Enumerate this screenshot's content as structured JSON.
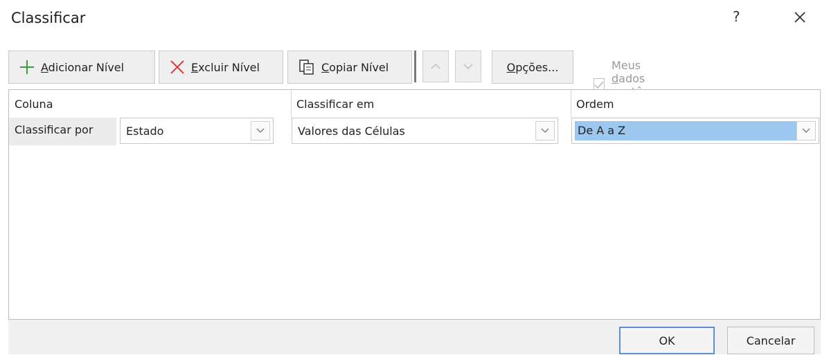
{
  "window": {
    "title": "Classificar",
    "help": "?"
  },
  "toolbar": {
    "add_level": {
      "mnemonic": "A",
      "rest": "dicionar Nível"
    },
    "delete_level": {
      "mnemonic": "E",
      "rest": "xcluir Nível"
    },
    "copy_level": {
      "mnemonic": "C",
      "rest": "opiar Nível"
    },
    "options": {
      "mnemonic": "O",
      "rest": "pções..."
    },
    "has_headers": {
      "pre": "Meus ",
      "mnemonic": "d",
      "post": "ados contêm cabeçalhos",
      "checked": true,
      "enabled": false
    }
  },
  "grid": {
    "headers": {
      "column": "Coluna",
      "sort_on": "Classificar em",
      "order": "Ordem"
    },
    "rows": [
      {
        "label": "Classificar por",
        "column": "Estado",
        "sort_on": "Valores das Células",
        "order": "De A a Z"
      }
    ]
  },
  "footer": {
    "ok": "OK",
    "cancel": "Cancelar"
  },
  "colors": {
    "add_icon": "#3c9a3c",
    "delete_icon": "#e03a3a",
    "selection": "#9cc7ef",
    "ok_border": "#5a8fd0"
  }
}
